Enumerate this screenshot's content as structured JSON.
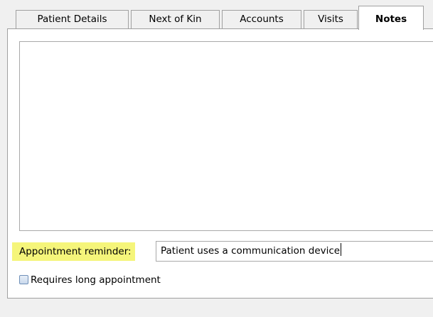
{
  "tabs": [
    {
      "label": "Patient Details",
      "active": false
    },
    {
      "label": "Next of Kin",
      "active": false
    },
    {
      "label": "Accounts",
      "active": false
    },
    {
      "label": "Visits",
      "active": false
    },
    {
      "label": "Notes",
      "active": true
    }
  ],
  "notes": {
    "text": ""
  },
  "appointment_reminder": {
    "label": "Appointment reminder:",
    "value": "Patient uses a communication device",
    "label_highlight_color": "#f5f57a"
  },
  "long_appointment": {
    "label": "Requires long appointment",
    "checked": false
  }
}
